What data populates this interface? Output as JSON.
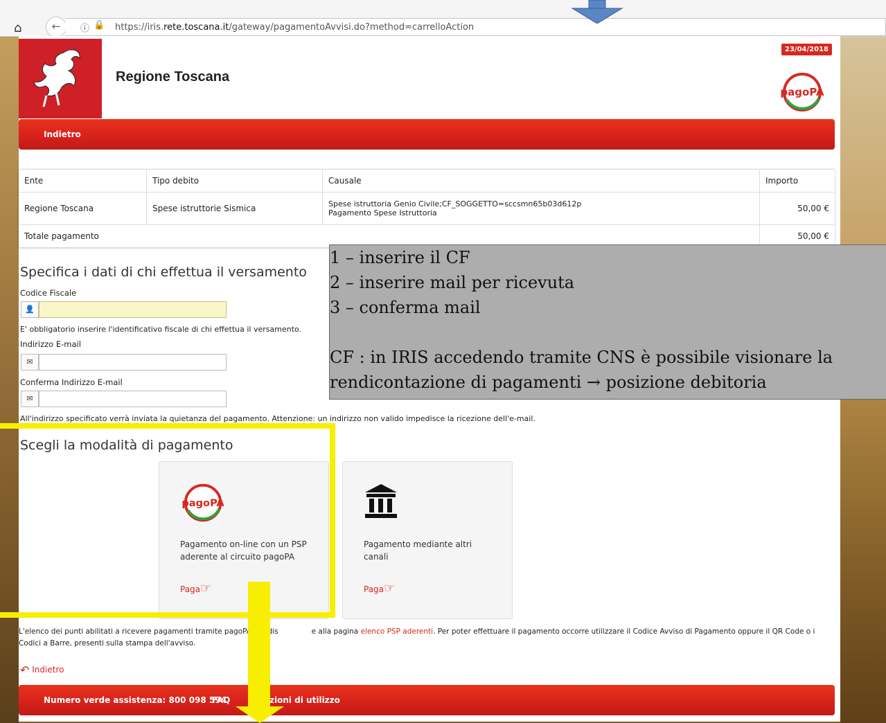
{
  "browser": {
    "url_prefix": "https://iris.",
    "url_domain": "rete.toscana.it",
    "url_path": "/gateway/pagamentoAvvisi.do?method=carrelloAction"
  },
  "header": {
    "title": "Regione Toscana",
    "date": "23/04/2018",
    "back_label": "Indietro"
  },
  "table": {
    "headers": [
      "Ente",
      "Tipo debito",
      "Causale",
      "Importo"
    ],
    "rows": [
      {
        "ente": "Regione Toscana",
        "tipo": "Spese istruttorie Sismica",
        "causale_1": "Spese istruttoria Genio Civile;CF_SOGGETTO=sccsmn65b03d612p",
        "causale_2": "Pagamento Spese Istruttoria",
        "importo": "50,00 €"
      }
    ],
    "total_label": "Totale pagamento",
    "total_value": "50,00 €"
  },
  "form": {
    "title": "Specifica i dati di chi effettua il versamento",
    "cf_label": "Codice Fiscale",
    "cf_note": "E' obbligatorio inserire l'identificativo fiscale di chi effettua il versamento.",
    "email_label": "Indirizzo E-mail",
    "email_confirm_label": "Conferma Indirizzo E-mail",
    "email_note": "All'indirizzo specificato verrà inviata la quietanza del pagamento. Attenzione: un indirizzo non valido impedisce la ricezione dell'e-mail."
  },
  "payment": {
    "title": "Scegli la modalità di pagamento",
    "options": [
      {
        "text": "Pagamento on-line con un PSP aderente al circuito pagoPA",
        "action": "Paga"
      },
      {
        "text": "Pagamento mediante altri canali",
        "action": "Paga"
      }
    ]
  },
  "footer_note": {
    "part1": "L'elenco dei punti abilitati a ricevere pagamenti tramite pagoPA® è dis",
    "part2": "e alla pagina ",
    "link": "elenco PSP aderenti",
    "part3": ". Per poter effettuare il pagamento occorre utilizzare il Codice Avviso di Pagamento oppure il QR Code o i Codici a Barre, presenti sulla stampa dell'avviso."
  },
  "back_link": "Indietro",
  "footer": {
    "numero_verde": "Numero verde assistenza: 800 098 594",
    "faq": "FAQ",
    "condizioni": "zioni di utilizzo"
  },
  "callout": {
    "lines": [
      "1 – inserire il CF",
      "2 – inserire mail per ricevuta",
      "3 – conferma mail",
      "",
      "CF : in IRIS accedendo tramite CNS è possibile visionare la",
      "rendicontazione di pagamenti → posizione debitoria"
    ]
  },
  "colors": {
    "accent_red": "#d7281f",
    "highlight_yellow": "#f7ee00",
    "callout_gray": "#adadad"
  }
}
